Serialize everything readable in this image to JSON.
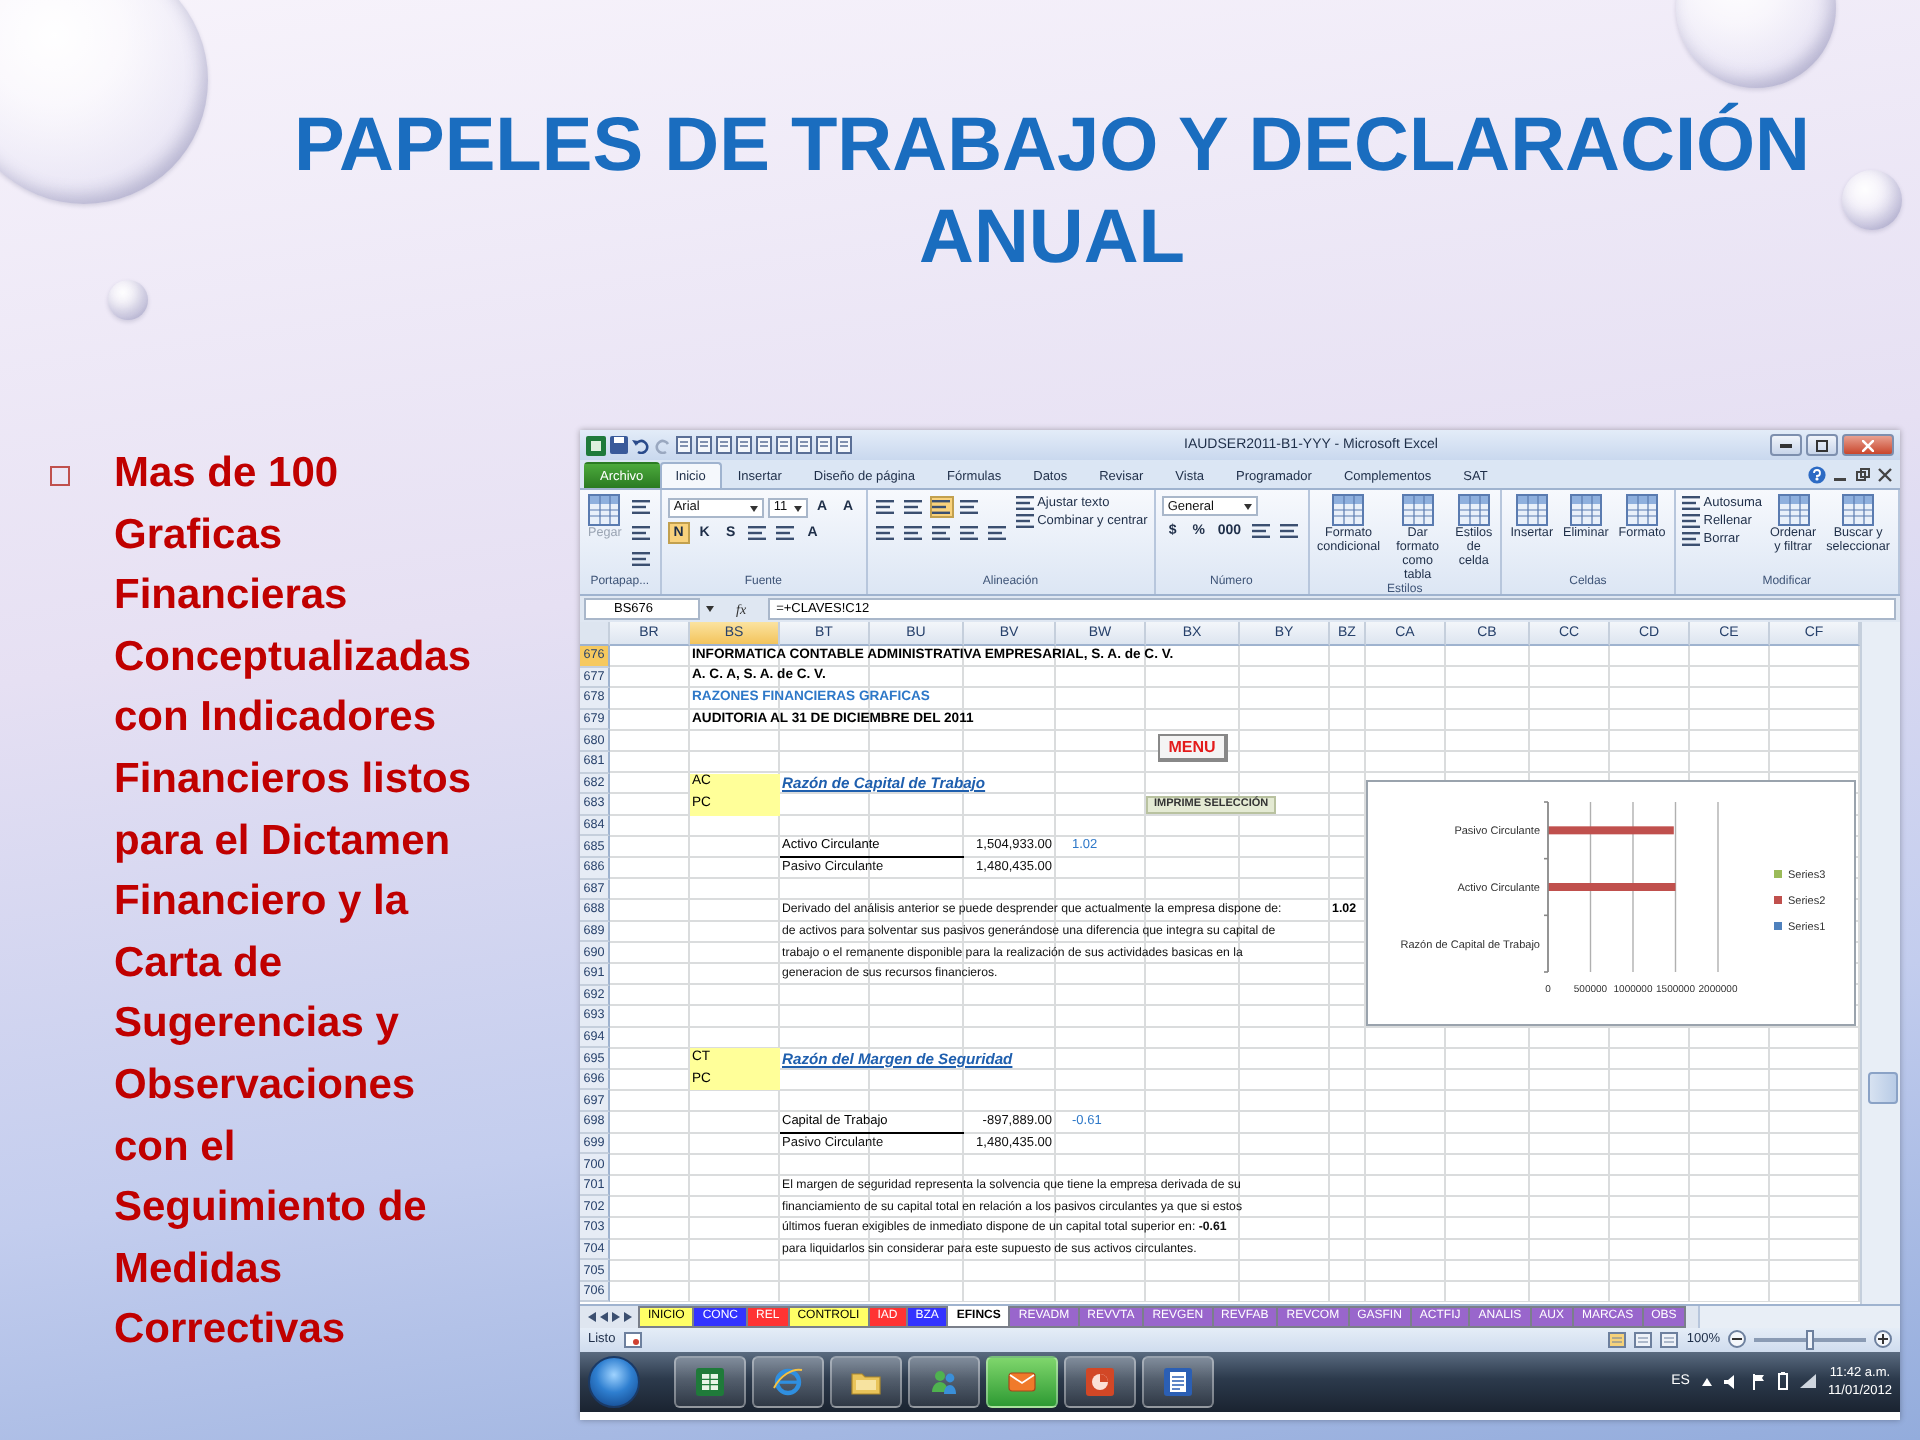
{
  "title": "PAPELES DE TRABAJO Y DECLARACIÓN ANUAL",
  "bullet_text": "Mas de 100 Graficas Financieras Conceptualizadas con Indicadores Financieros listos para el Dictamen Financiero y la Carta de Sugerencias y Observaciones con el Seguimiento de Medidas Correctivas",
  "excel": {
    "window_title": "IAUDSER2011-B1-YYY - Microsoft Excel",
    "ribbon_tabs": [
      {
        "label": "Archivo",
        "kind": "file",
        "selected": false
      },
      {
        "label": "Inicio",
        "kind": "tab",
        "selected": true
      },
      {
        "label": "Insertar",
        "kind": "tab",
        "selected": false
      },
      {
        "label": "Diseño de página",
        "kind": "tab",
        "selected": false
      },
      {
        "label": "Fórmulas",
        "kind": "tab",
        "selected": false
      },
      {
        "label": "Datos",
        "kind": "tab",
        "selected": false
      },
      {
        "label": "Revisar",
        "kind": "tab",
        "selected": false
      },
      {
        "label": "Vista",
        "kind": "tab",
        "selected": false
      },
      {
        "label": "Programador",
        "kind": "tab",
        "selected": false
      },
      {
        "label": "Complementos",
        "kind": "tab",
        "selected": false
      },
      {
        "label": "SAT",
        "kind": "tab",
        "selected": false
      }
    ],
    "ribbon_groups": [
      {
        "label": "Portapap...",
        "items": [
          {
            "kind": "large",
            "text": "Pegar",
            "disabled": true
          },
          {
            "kind": "stack",
            "rows": [
              [
                {
                  "kind": "icon",
                  "on": false
                }
              ],
              [
                {
                  "kind": "icon",
                  "on": false
                }
              ],
              [
                {
                  "kind": "icon",
                  "on": false
                }
              ]
            ]
          }
        ]
      },
      {
        "label": "Fuente",
        "items": [
          {
            "kind": "stack",
            "rows": [
              [
                {
                  "kind": "field",
                  "text": "Arial"
                },
                {
                  "kind": "field",
                  "text": "11"
                },
                {
                  "kind": "glyph",
                  "text": "A",
                  "on": false
                },
                {
                  "kind": "glyph",
                  "text": "A",
                  "on": false
                }
              ],
              [
                {
                  "kind": "glyph",
                  "text": "N",
                  "on": true
                },
                {
                  "kind": "glyph",
                  "text": "K",
                  "on": false
                },
                {
                  "kind": "glyph",
                  "text": "S",
                  "on": false
                },
                {
                  "kind": "icon",
                  "on": false
                },
                {
                  "kind": "icon",
                  "on": false
                },
                {
                  "kind": "glyph",
                  "text": "A",
                  "on": false
                }
              ]
            ]
          }
        ]
      },
      {
        "label": "Alineación",
        "items": [
          {
            "kind": "stack",
            "rows": [
              [
                {
                  "kind": "icon",
                  "on": false
                },
                {
                  "kind": "icon",
                  "on": false
                },
                {
                  "kind": "icon",
                  "on": true
                },
                {
                  "kind": "icon",
                  "on": false
                }
              ],
              [
                {
                  "kind": "icon",
                  "on": false
                },
                {
                  "kind": "icon",
                  "on": false
                },
                {
                  "kind": "icon",
                  "on": false
                },
                {
                  "kind": "icon",
                  "on": false
                },
                {
                  "kind": "icon",
                  "on": false
                }
              ]
            ]
          },
          {
            "kind": "stack",
            "rows": [
              [
                {
                  "kind": "small",
                  "text": "Ajustar texto"
                }
              ],
              [
                {
                  "kind": "small",
                  "text": "Combinar y centrar"
                }
              ]
            ]
          }
        ]
      },
      {
        "label": "Número",
        "items": [
          {
            "kind": "stack",
            "rows": [
              [
                {
                  "kind": "field",
                  "text": "General"
                }
              ],
              [
                {
                  "kind": "glyph",
                  "text": "$",
                  "on": false
                },
                {
                  "kind": "glyph",
                  "text": "%",
                  "on": false
                },
                {
                  "kind": "glyph",
                  "text": "000",
                  "on": false
                },
                {
                  "kind": "icon",
                  "on": false
                },
                {
                  "kind": "icon",
                  "on": false
                }
              ]
            ]
          }
        ]
      },
      {
        "label": "Estilos",
        "items": [
          {
            "kind": "large",
            "text": "Formato condicional",
            "disabled": false
          },
          {
            "kind": "large",
            "text": "Dar formato como tabla",
            "disabled": false
          },
          {
            "kind": "large",
            "text": "Estilos de celda",
            "disabled": false
          }
        ]
      },
      {
        "label": "Celdas",
        "items": [
          {
            "kind": "large",
            "text": "Insertar",
            "disabled": false
          },
          {
            "kind": "large",
            "text": "Eliminar",
            "disabled": false
          },
          {
            "kind": "large",
            "text": "Formato",
            "disabled": false
          }
        ]
      },
      {
        "label": "Modificar",
        "items": [
          {
            "kind": "stack",
            "rows": [
              [
                {
                  "kind": "small",
                  "text": "Autosuma"
                }
              ],
              [
                {
                  "kind": "small",
                  "text": "Rellenar"
                }
              ],
              [
                {
                  "kind": "small",
                  "text": "Borrar"
                }
              ]
            ]
          },
          {
            "kind": "large",
            "text": "Ordenar y filtrar",
            "disabled": false
          },
          {
            "kind": "large",
            "text": "Buscar y seleccionar",
            "disabled": false
          }
        ]
      }
    ],
    "name_box": "BS676",
    "formula_label": "fx",
    "formula": "=+CLAVES!C12",
    "columns": [
      {
        "label": "BR",
        "selected": false
      },
      {
        "label": "BS",
        "selected": true
      },
      {
        "label": "BT",
        "selected": false
      },
      {
        "label": "BU",
        "selected": false
      },
      {
        "label": "BV",
        "selected": false
      },
      {
        "label": "BW",
        "selected": false
      },
      {
        "label": "BX",
        "selected": false
      },
      {
        "label": "BY",
        "selected": false
      },
      {
        "label": "BZ",
        "selected": false
      },
      {
        "label": "CA",
        "selected": false
      },
      {
        "label": "CB",
        "selected": false
      },
      {
        "label": "CC",
        "selected": false
      },
      {
        "label": "CD",
        "selected": false
      },
      {
        "label": "CE",
        "selected": false
      },
      {
        "label": "CF",
        "selected": false
      }
    ],
    "rows": [
      {
        "number": "676",
        "selected": true,
        "cells": {
          "BS": {
            "kind": "bold",
            "text": "INFORMATICA CONTABLE ADMINISTRATIVA EMPRESARIAL, S. A. de C. V."
          }
        }
      },
      {
        "number": "677",
        "selected": false,
        "cells": {
          "BS": {
            "kind": "bold",
            "text": "A. C. A,  S. A. de  C. V."
          }
        }
      },
      {
        "number": "678",
        "selected": false,
        "cells": {
          "BS": {
            "kind": "blue",
            "text": "RAZONES FINANCIERAS GRAFICAS"
          }
        }
      },
      {
        "number": "679",
        "selected": false,
        "cells": {
          "BS": {
            "kind": "bold",
            "text": "AUDITORIA AL 31 DE DICIEMBRE DEL 2011"
          }
        }
      },
      {
        "number": "680",
        "selected": false,
        "cells": {
          "BX": {
            "kind": "menu",
            "text": "MENU"
          }
        }
      },
      {
        "number": "681",
        "selected": false
      },
      {
        "number": "682",
        "selected": false,
        "cells": {
          "BS": {
            "kind": "tag",
            "text": "AC"
          },
          "BT": {
            "kind": "heading",
            "text": "Razón de Capital de Trabajo"
          }
        }
      },
      {
        "number": "683",
        "selected": false,
        "cells": {
          "BS": {
            "kind": "tag",
            "text": "PC"
          },
          "BX": {
            "kind": "print",
            "text": "IMPRIME SELECCIÓN"
          }
        }
      },
      {
        "number": "684",
        "selected": false
      },
      {
        "number": "685",
        "selected": false,
        "cells": {
          "BT": {
            "kind": "numerator",
            "text": "Activo Circulante"
          },
          "BV": {
            "kind": "amount",
            "text": "1,504,933.00"
          },
          "BW": {
            "kind": "result",
            "text": "1.02"
          }
        }
      },
      {
        "number": "686",
        "selected": false,
        "cells": {
          "BT": {
            "kind": "plain",
            "text": "Pasivo Circulante"
          },
          "BV": {
            "kind": "amount",
            "text": "1,480,435.00"
          }
        }
      },
      {
        "number": "687",
        "selected": false
      },
      {
        "number": "688",
        "selected": false,
        "cells": {
          "BT": {
            "kind": "note",
            "text": "Derivado del análisis anterior se puede desprender que actualmente la empresa dispone de:"
          },
          "BZ": {
            "kind": "figure",
            "text": "1.02"
          }
        }
      },
      {
        "number": "689",
        "selected": false,
        "cells": {
          "BT": {
            "kind": "note",
            "text": "de activos para solventar sus pasivos generándose una diferencia que integra su capital de"
          }
        }
      },
      {
        "number": "690",
        "selected": false,
        "cells": {
          "BT": {
            "kind": "note",
            "text": "trabajo o el remanente disponible para la realización de sus actividades basicas en la"
          }
        }
      },
      {
        "number": "691",
        "selected": false,
        "cells": {
          "BT": {
            "kind": "note",
            "text": "generacion de sus recursos financieros."
          }
        }
      },
      {
        "number": "692",
        "selected": false
      },
      {
        "number": "693",
        "selected": false
      },
      {
        "number": "694",
        "selected": false
      },
      {
        "number": "695",
        "selected": false,
        "cells": {
          "BS": {
            "kind": "tag",
            "text": "CT"
          },
          "BT": {
            "kind": "heading",
            "text": "Razón del Margen de Seguridad"
          }
        }
      },
      {
        "number": "696",
        "selected": false,
        "cells": {
          "BS": {
            "kind": "tag",
            "text": "PC"
          }
        }
      },
      {
        "number": "697",
        "selected": false
      },
      {
        "number": "698",
        "selected": false,
        "cells": {
          "BT": {
            "kind": "numerator",
            "text": "Capital de Trabajo"
          },
          "BV": {
            "kind": "amount",
            "text": "-897,889.00"
          },
          "BW": {
            "kind": "result",
            "text": "-0.61"
          }
        }
      },
      {
        "number": "699",
        "selected": false,
        "cells": {
          "BT": {
            "kind": "plain",
            "text": "Pasivo Circulante"
          },
          "BV": {
            "kind": "amount",
            "text": "1,480,435.00"
          }
        }
      },
      {
        "number": "700",
        "selected": false
      },
      {
        "number": "701",
        "selected": false,
        "cells": {
          "BT": {
            "kind": "note",
            "text": "El margen de seguridad representa la solvencia que tiene la empresa  derivada de  su"
          }
        }
      },
      {
        "number": "702",
        "selected": false,
        "cells": {
          "BT": {
            "kind": "note",
            "text": "financiamiento de su capital total en relación a los pasivos circulantes ya que si  estos"
          }
        }
      },
      {
        "number": "703",
        "selected": false,
        "cells": {
          "BT": {
            "kind": "note",
            "text": "últimos fueran exigibles de inmediato dispone de un capital total superior en: **-0.61**"
          }
        }
      },
      {
        "number": "704",
        "selected": false,
        "cells": {
          "BT": {
            "kind": "note",
            "text": "para liquidarlos sin considerar para este supuesto de sus activos circulantes."
          }
        }
      },
      {
        "number": "705",
        "selected": false
      },
      {
        "number": "706",
        "selected": false
      }
    ],
    "chart": {
      "chart_data": {
        "type": "bar",
        "orientation": "horizontal",
        "grid": true,
        "categories": [
          "Pasivo Circulante",
          "Activo Circulante",
          "Razón de Capital de Trabajo"
        ],
        "series": [
          {
            "name": "Series1",
            "color": "#4f81bd",
            "values": [
              null,
              null,
              null
            ]
          },
          {
            "name": "Series2",
            "color": "#c0504d",
            "values": [
              1480000,
              1500000,
              null
            ]
          },
          {
            "name": "Series3",
            "color": "#9bbb59",
            "values": [
              null,
              null,
              null
            ]
          }
        ],
        "xlim": [
          0,
          2000000
        ],
        "xticks": [
          0,
          500000,
          1000000,
          1500000,
          2000000
        ]
      }
    },
    "sheet_tabs": [
      {
        "label": "INICIO",
        "color": "#ffff66",
        "selected": false
      },
      {
        "label": "CONC",
        "color": "#3333ff",
        "selected": false
      },
      {
        "label": "REL",
        "color": "#ff3333",
        "selected": false
      },
      {
        "label": "CONTROLI",
        "color": "#ffff66",
        "selected": false
      },
      {
        "label": "IAD",
        "color": "#ff3333",
        "selected": false
      },
      {
        "label": "BZA",
        "color": "#3333ff",
        "selected": false
      },
      {
        "label": "EFINCS",
        "color": "#ffffff",
        "selected": true
      },
      {
        "label": "REVADM",
        "color": "#9966cc",
        "selected": false
      },
      {
        "label": "REVVTA",
        "color": "#9966cc",
        "selected": false
      },
      {
        "label": "REVGEN",
        "color": "#9966cc",
        "selected": false
      },
      {
        "label": "REVFAB",
        "color": "#9966cc",
        "selected": false
      },
      {
        "label": "REVCOM",
        "color": "#9966cc",
        "selected": false
      },
      {
        "label": "GASFIN",
        "color": "#9966cc",
        "selected": false
      },
      {
        "label": "ACTFIJ",
        "color": "#9966cc",
        "selected": false
      },
      {
        "label": "ANALIS",
        "color": "#9966cc",
        "selected": false
      },
      {
        "label": "AUX",
        "color": "#9966cc",
        "selected": false
      },
      {
        "label": "MARCAS",
        "color": "#9966cc",
        "selected": false
      },
      {
        "label": "OBS",
        "color": "#9966cc",
        "selected": false
      }
    ],
    "status": "Listo",
    "zoom": {
      "reading": "100%",
      "level": 0.5
    }
  },
  "taskbar": {
    "apps": [
      {
        "kind": "spreadsheet",
        "highlighted": false
      },
      {
        "kind": "browser",
        "highlighted": false
      },
      {
        "kind": "folder",
        "highlighted": false
      },
      {
        "kind": "messenger",
        "highlighted": false
      },
      {
        "kind": "mail",
        "highlighted": true
      },
      {
        "kind": "presentation",
        "highlighted": false
      },
      {
        "kind": "document",
        "highlighted": false
      }
    ],
    "language": "ES",
    "time": "11:42 a.m.",
    "date": "11/01/2012"
  }
}
